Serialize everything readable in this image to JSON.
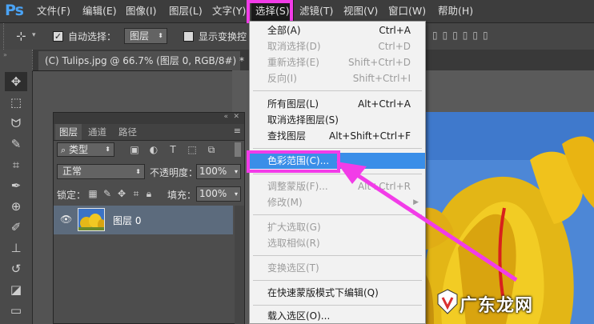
{
  "app": {
    "logo": "Ps"
  },
  "menubar": {
    "items": [
      "文件(F)",
      "编辑(E)",
      "图像(I)",
      "图层(L)",
      "文字(Y)",
      "选择(S)",
      "滤镜(T)",
      "视图(V)",
      "窗口(W)",
      "帮助(H)"
    ]
  },
  "options": {
    "auto_select_label": "自动选择：",
    "auto_select_value": "图层",
    "show_transform_label": "显示变换控件"
  },
  "document_tab": {
    "title": "(C) Tulips.jpg @ 66.7% (图层 0, RGB/8#) *"
  },
  "layers_panel": {
    "tabs": [
      "图层",
      "通道",
      "路径"
    ],
    "filter_type": "类型",
    "blend_mode": "正常",
    "opacity_label": "不透明度：",
    "opacity_value": "100%",
    "lock_label": "锁定：",
    "fill_label": "填充：",
    "fill_value": "100%",
    "layer_name": "图层 0"
  },
  "select_menu": {
    "items": [
      {
        "label": "全部(A)",
        "shortcut": "Ctrl+A",
        "enabled": true
      },
      {
        "label": "取消选择(D)",
        "shortcut": "Ctrl+D",
        "enabled": false
      },
      {
        "label": "重新选择(E)",
        "shortcut": "Shift+Ctrl+D",
        "enabled": false
      },
      {
        "label": "反向(I)",
        "shortcut": "Shift+Ctrl+I",
        "enabled": false
      },
      {
        "label": "所有图层(L)",
        "shortcut": "Alt+Ctrl+A",
        "enabled": true
      },
      {
        "label": "取消选择图层(S)",
        "shortcut": "",
        "enabled": true
      },
      {
        "label": "查找图层",
        "shortcut": "Alt+Shift+Ctrl+F",
        "enabled": true
      },
      {
        "label": "色彩范围(C)...",
        "shortcut": "",
        "enabled": true
      },
      {
        "label": "调整蒙版(F)...",
        "shortcut": "Alt+Ctrl+R",
        "enabled": false
      },
      {
        "label": "修改(M)",
        "shortcut": "",
        "enabled": false
      },
      {
        "label": "扩大选取(G)",
        "shortcut": "",
        "enabled": false
      },
      {
        "label": "选取相似(R)",
        "shortcut": "",
        "enabled": false
      },
      {
        "label": "变换选区(T)",
        "shortcut": "",
        "enabled": false
      },
      {
        "label": "在快速蒙版模式下编辑(Q)",
        "shortcut": "",
        "enabled": true
      },
      {
        "label": "载入选区(O)...",
        "shortcut": "",
        "enabled": true
      }
    ]
  },
  "watermark": {
    "text": "广东龙网"
  },
  "colors": {
    "highlight": "#f23ce8",
    "menu_selected": "#3a8ee8",
    "ps_blue": "#4aa3f5"
  }
}
